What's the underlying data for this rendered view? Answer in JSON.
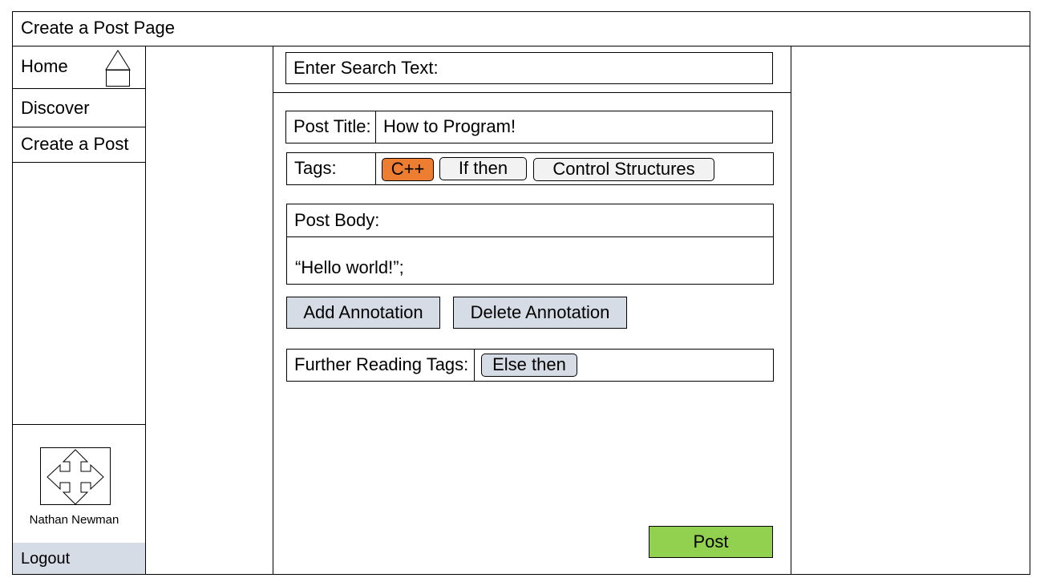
{
  "header": {
    "title": "Create a Post Page"
  },
  "sidebar": {
    "items": [
      {
        "label": "Home",
        "icon": "home-icon"
      },
      {
        "label": "Discover"
      },
      {
        "label": "Create a Post"
      }
    ],
    "user": {
      "name": "Nathan Newman",
      "avatar_icon": "move-arrows-icon"
    },
    "logout_label": "Logout"
  },
  "search": {
    "label": "Enter Search Text:"
  },
  "post": {
    "title_label": "Post Title:",
    "title_value": "How to Program!",
    "tags_label": "Tags:",
    "tags": [
      "C++",
      "If then",
      "Control Structures"
    ],
    "body_label": "Post Body:",
    "body_value": "“Hello world!”;",
    "add_annotation_label": "Add Annotation",
    "delete_annotation_label": "Delete Annotation",
    "further_label": "Further Reading Tags:",
    "further_tags": [
      "Else then"
    ],
    "post_label": "Post"
  },
  "colors": {
    "tag_cpp": "#ed7d31",
    "tag_default": "#f2f2f2",
    "button_bg": "#d6dce5",
    "post_button": "#92d050"
  }
}
